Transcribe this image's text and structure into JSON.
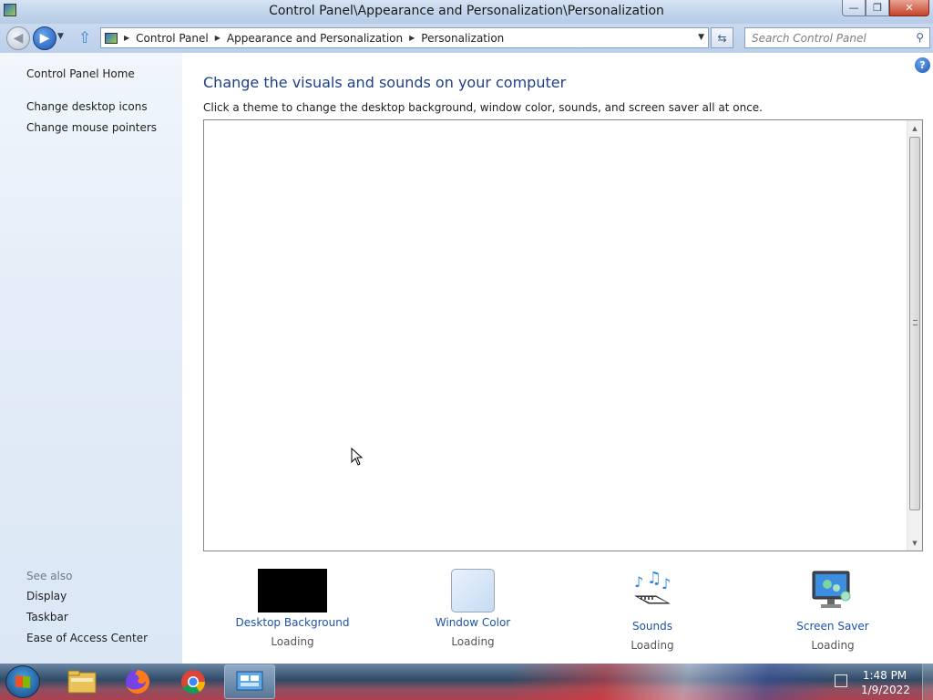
{
  "window": {
    "title": "Control Panel\\Appearance and Personalization\\Personalization",
    "min_symbol": "—",
    "max_symbol": "❐",
    "close_symbol": "✕"
  },
  "nav": {
    "breadcrumbs": [
      "Control Panel",
      "Appearance and Personalization",
      "Personalization"
    ],
    "search_placeholder": "Search Control Panel"
  },
  "left_pane": {
    "home": "Control Panel Home",
    "links": [
      "Change desktop icons",
      "Change mouse pointers"
    ],
    "see_also_label": "See also",
    "see_also": [
      "Display",
      "Taskbar",
      "Ease of Access Center"
    ]
  },
  "main": {
    "title": "Change the visuals and sounds on your computer",
    "description": "Click a theme to change the desktop background, window color, sounds, and screen saver all at once.",
    "help_symbol": "?"
  },
  "bottom_items": [
    {
      "label": "Desktop Background",
      "status": "Loading",
      "icon": "desktop-background-icon"
    },
    {
      "label": "Window Color",
      "status": "Loading",
      "icon": "window-color-icon"
    },
    {
      "label": "Sounds",
      "status": "Loading",
      "icon": "sounds-icon"
    },
    {
      "label": "Screen Saver",
      "status": "Loading",
      "icon": "screen-saver-icon"
    }
  ],
  "taskbar": {
    "apps": [
      "file-explorer-icon",
      "firefox-icon",
      "chrome-icon",
      "control-panel-icon"
    ],
    "time": "1:48 PM",
    "date": "1/9/2022"
  },
  "colors": {
    "link": "#1e52a8",
    "title": "#1f3f8a"
  }
}
